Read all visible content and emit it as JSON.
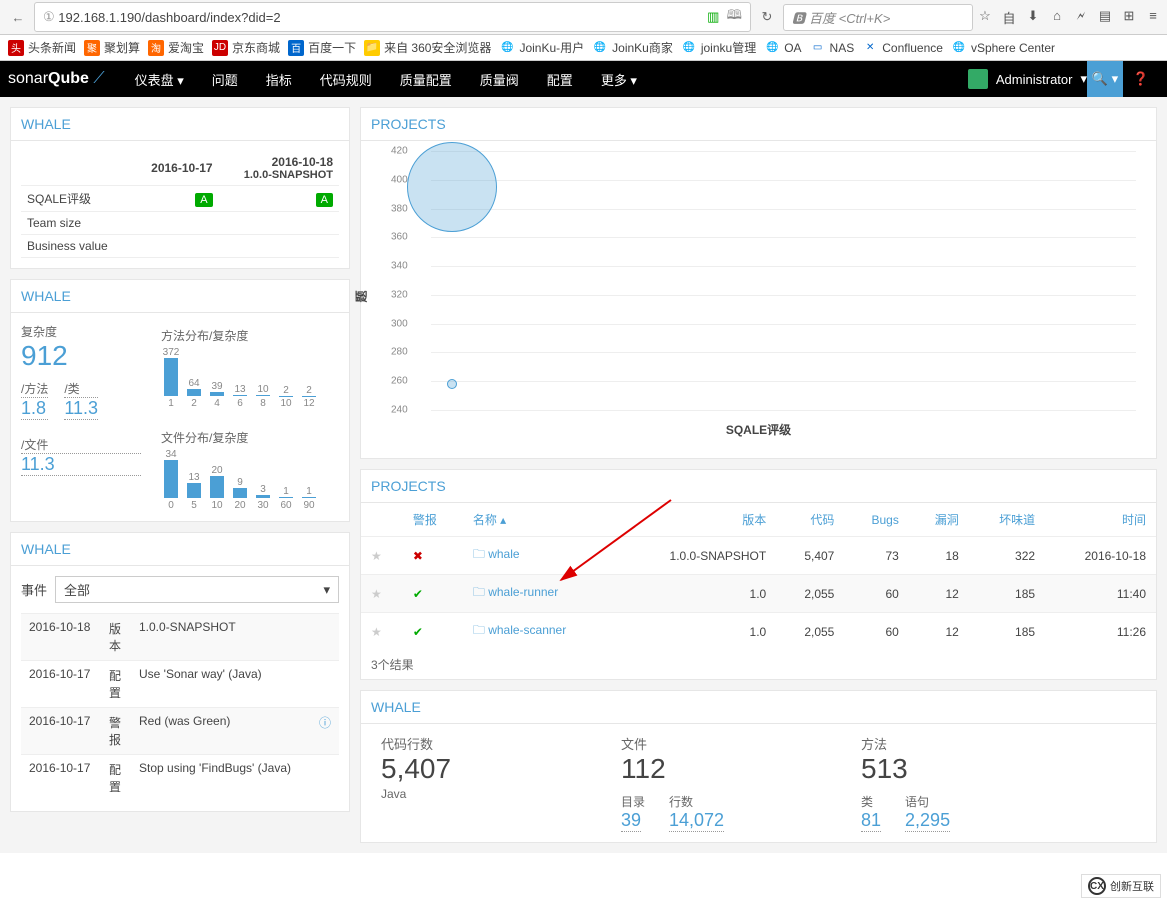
{
  "browser": {
    "url_prefix": "①",
    "url": "192.168.1.190/dashboard/index?did=2",
    "search_placeholder": "百度 <Ctrl+K>",
    "bookmarks": [
      {
        "label": "头条新闻",
        "icon": "bi-red"
      },
      {
        "label": "聚划算",
        "icon": "bi-orange"
      },
      {
        "label": "爱淘宝",
        "icon": "bi-orange"
      },
      {
        "label": "京东商城",
        "icon": "bi-jd"
      },
      {
        "label": "百度一下",
        "icon": "bi-blue"
      },
      {
        "label": "来自 360安全浏览器",
        "icon": "bi-yellow"
      },
      {
        "label": "JoinKu-用户",
        "icon": "bi-globe"
      },
      {
        "label": "JoinKu商家",
        "icon": "bi-globe"
      },
      {
        "label": "joinku管理",
        "icon": "bi-globe"
      },
      {
        "label": "OA",
        "icon": "bi-globe"
      },
      {
        "label": "NAS",
        "icon": "bi-globe"
      },
      {
        "label": "Confluence",
        "icon": "bi-globe"
      },
      {
        "label": "vSphere Center",
        "icon": "bi-globe"
      }
    ]
  },
  "header": {
    "logo1": "sonar",
    "logo2": "Qube",
    "nav": [
      "仪表盘 ▾",
      "问题",
      "指标",
      "代码规则",
      "质量配置",
      "质量阀",
      "配置",
      "更多 ▾"
    ],
    "user": "Administrator"
  },
  "panel1": {
    "title": "WHALE",
    "col1": "2016-10-17",
    "col2_date": "2016-10-18",
    "col2_ver": "1.0.0-SNAPSHOT",
    "rows": [
      {
        "label": "SQALE评级",
        "v1": "A",
        "v2": "A"
      },
      {
        "label": "Team size",
        "v1": "",
        "v2": ""
      },
      {
        "label": "Business value",
        "v1": "",
        "v2": ""
      }
    ]
  },
  "panel2": {
    "title": "WHALE",
    "complexity_label": "复杂度",
    "complexity_value": "912",
    "per_method_label": "/方法",
    "per_method_value": "1.8",
    "per_class_label": "/类",
    "per_class_value": "11.3",
    "per_file_label": "/文件",
    "per_file_value": "11.3",
    "chart1_title": "方法分布/复杂度",
    "chart2_title": "文件分布/复杂度"
  },
  "panel3": {
    "title": "WHALE",
    "event_label": "事件",
    "select_value": "全部",
    "events": [
      {
        "date": "2016-10-18",
        "type": "版本",
        "desc": "1.0.0-SNAPSHOT",
        "info": false
      },
      {
        "date": "2016-10-17",
        "type": "配置",
        "desc": "Use 'Sonar way' (Java)",
        "info": false
      },
      {
        "date": "2016-10-17",
        "type": "警报",
        "desc": "Red (was Green)",
        "info": true
      },
      {
        "date": "2016-10-17",
        "type": "配置",
        "desc": "Stop using 'FindBugs' (Java)",
        "info": false
      }
    ]
  },
  "projects_chart": {
    "title": "PROJECTS",
    "y_label": "题",
    "x_label": "SQALE评级",
    "y_ticks": [
      "240",
      "260",
      "280",
      "300",
      "320",
      "340",
      "360",
      "380",
      "400",
      "420"
    ]
  },
  "projects_table": {
    "title": "PROJECTS",
    "headers": {
      "alert": "警报",
      "name": "名称 ▴",
      "version": "版本",
      "loc": "代码",
      "bugs": "Bugs",
      "vuln": "漏洞",
      "smell": "坏味道",
      "time": "时间"
    },
    "rows": [
      {
        "fav": false,
        "status": "fail",
        "name": "whale",
        "version": "1.0.0-SNAPSHOT",
        "loc": "5,407",
        "bugs": "73",
        "vuln": "18",
        "smell": "322",
        "time": "2016-10-18"
      },
      {
        "fav": false,
        "status": "ok",
        "name": "whale-runner",
        "version": "1.0",
        "loc": "2,055",
        "bugs": "60",
        "vuln": "12",
        "smell": "185",
        "time": "11:40"
      },
      {
        "fav": false,
        "status": "ok",
        "name": "whale-scanner",
        "version": "1.0",
        "loc": "2,055",
        "bugs": "60",
        "vuln": "12",
        "smell": "185",
        "time": "11:26"
      }
    ],
    "results_count": "3个结果"
  },
  "whale_stats": {
    "title": "WHALE",
    "loc_label": "代码行数",
    "loc_value": "5,407",
    "lang": "Java",
    "files_label": "文件",
    "files_value": "112",
    "dirs_label": "目录",
    "dirs_value": "39",
    "lines_label": "行数",
    "lines_value": "14,072",
    "methods_label": "方法",
    "methods_value": "513",
    "classes_label": "类",
    "classes_value": "81",
    "stmts_label": "语句",
    "stmts_value": "2,295"
  },
  "chart_data": [
    {
      "type": "bar",
      "title": "方法分布/复杂度",
      "categories": [
        "1",
        "2",
        "4",
        "6",
        "8",
        "10",
        "12"
      ],
      "values": [
        372,
        64,
        39,
        13,
        10,
        2,
        2
      ]
    },
    {
      "type": "bar",
      "title": "文件分布/复杂度",
      "categories": [
        "0",
        "5",
        "10",
        "20",
        "30",
        "60",
        "90"
      ],
      "values": [
        34,
        13,
        20,
        9,
        3,
        1,
        1
      ]
    },
    {
      "type": "scatter",
      "title": "PROJECTS",
      "xlabel": "SQALE评级",
      "ylabel": "题",
      "ylim": [
        240,
        420
      ],
      "series": [
        {
          "name": "bubble1",
          "x": 1,
          "y": 395,
          "size": 90
        },
        {
          "name": "bubble2",
          "x": 1,
          "y": 258,
          "size": 10
        }
      ]
    }
  ],
  "watermark": "创新互联"
}
